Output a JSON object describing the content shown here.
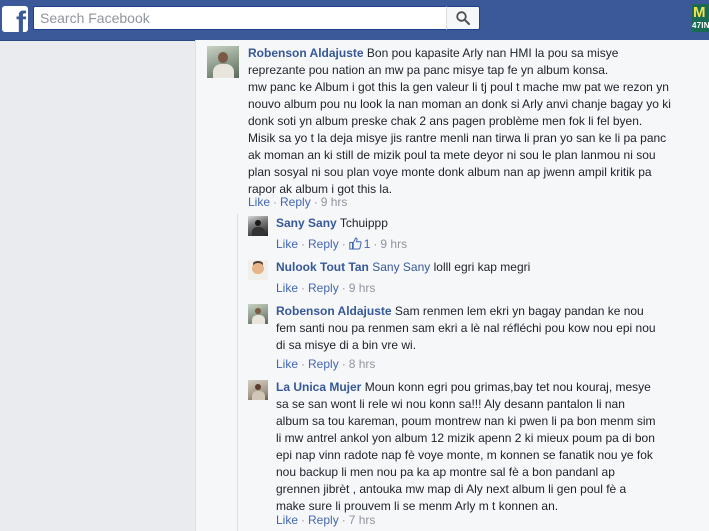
{
  "header": {
    "logo": "f",
    "search_placeholder": "Search Facebook",
    "corner_thumb_text_top": "M",
    "corner_thumb_text_bottom": "47IN"
  },
  "comments": [
    {
      "author": "Robenson Aldajuste",
      "text_lines": [
        "Bon pou kapasite Arly nan HMI la pou sa misye",
        "reprezante pou nation an mw pa panc misye tap fe yn album konsa.",
        "mw panc ke Album i got this la gen valeur li tj poul t mache mw pat we rezon yn",
        "nouvo album pou nu look la nan moman an donk si Arly anvi chanje bagay yo ki",
        "donk soti yn album preske chak 2 ans pagen problème men fok li fel byen.",
        "Misik sa yo t la deja misye jis rantre menli nan tirwa li pran yo san ke li pa panc",
        "ak moman an ki still de mizik poul ta mete deyor ni sou le plan lanmou ni sou",
        "plan sosyal ni sou plan voye monte donk album nan ap jwenn ampil kritik pa",
        "rapor ak album i got this la."
      ],
      "like": "Like",
      "reply": "Reply",
      "time": "9 hrs"
    },
    {
      "author": "Sany Sany",
      "text": "Tchuippp",
      "like": "Like",
      "reply": "Reply",
      "like_count": "1",
      "time": "9 hrs"
    },
    {
      "author": "Nulook Tout Tan",
      "mention": "Sany Sany",
      "text": "lolll egri kap megri",
      "like": "Like",
      "reply": "Reply",
      "time": "9 hrs"
    },
    {
      "author": "Robenson Aldajuste",
      "text_lines": [
        "Sam renmen lem ekri yn bagay pandan ke nou",
        "fem santi nou pa renmen sam ekri a lè nal réfléchi pou kow nou epi nou",
        "di sa misye di a bin vre wi."
      ],
      "like": "Like",
      "reply": "Reply",
      "time": "8 hrs"
    },
    {
      "author": "La Unica Mujer",
      "text_lines": [
        "Moun konn egri pou grimas,bay tet nou kouraj, mesye",
        "sa se san wont li rele wi nou konn sa!!! Aly desann pantalon li nan",
        "album sa tou kareman, poum montrew nan ki pwen li pa bon menm sim",
        "li mw antrel ankol yon album 12 mizik apenn 2 ki mieux poum pa di bon",
        "epi nap vinn radote nap fè voye monte, m konnen se fanatik nou ye fok",
        "nou backup li men nou pa ka ap montre sal fè a bon pandanl ap",
        "grennen jibrèt , antouka mw map di Aly next album li gen poul fè a",
        "make sure li prouvem li se menm Arly m t konnen an."
      ],
      "like": "Like",
      "reply": "Reply",
      "time": "7 hrs"
    }
  ]
}
